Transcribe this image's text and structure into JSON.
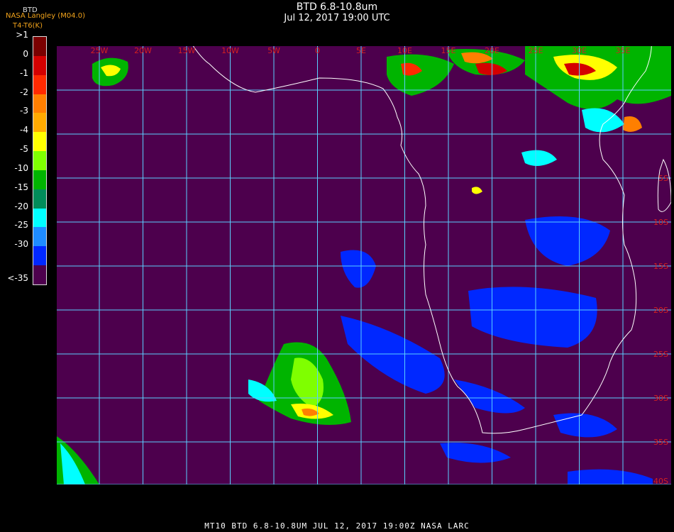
{
  "header": {
    "title": "BTD 6.8-10.8um",
    "subtitle": "Jul 12, 2017 19:00 UTC",
    "source_tag": "NASA Langley (M04.0)",
    "legend_title": "BTD",
    "legend_unit": "T4-T6(K)"
  },
  "legend": [
    {
      "label": ">1",
      "color": "#7a0000"
    },
    {
      "label": "0",
      "color": "#d40000"
    },
    {
      "label": "-1",
      "color": "#ff2a00"
    },
    {
      "label": "-2",
      "color": "#ff7f00"
    },
    {
      "label": "-3",
      "color": "#ffaa00"
    },
    {
      "label": "-4",
      "color": "#ffff00"
    },
    {
      "label": "-5",
      "color": "#7fff00"
    },
    {
      "label": "-10",
      "color": "#00b400"
    },
    {
      "label": "-15",
      "color": "#008c5a"
    },
    {
      "label": "-20",
      "color": "#00ffff"
    },
    {
      "label": "-25",
      "color": "#1e8cff"
    },
    {
      "label": "-30",
      "color": "#0028ff"
    },
    {
      "label": "<-35",
      "color": "#4d004d"
    }
  ],
  "lon_labels": [
    "25W",
    "20W",
    "15W",
    "10W",
    "5W",
    "0",
    "5E",
    "10E",
    "15E",
    "20E",
    "25E",
    "30E",
    "35E"
  ],
  "lat_labels": [
    "5S",
    "10S",
    "15S",
    "20S",
    "25S",
    "30S",
    "35S",
    "40S"
  ],
  "colors": {
    "background": "#4d004d",
    "grid": "#5ad0ff",
    "coast": "#ffffff",
    "axis_label": "#d42020"
  },
  "footer": "MT10  BTD 6.8-10.8UM  JUL 12, 2017 19:00Z  NASA LARC"
}
